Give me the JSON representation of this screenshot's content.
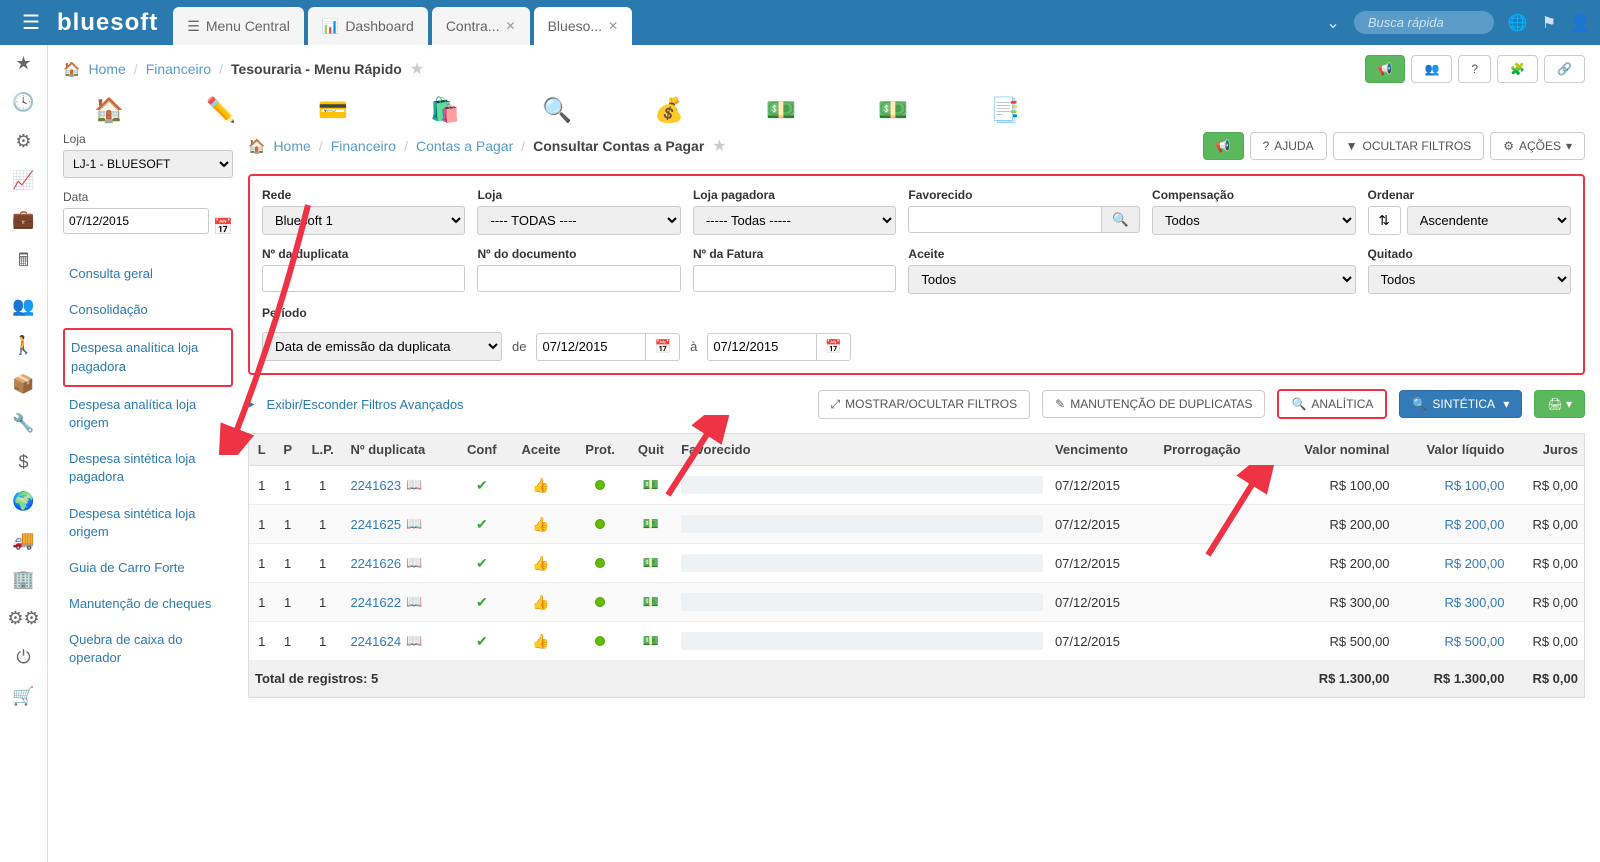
{
  "topbar": {
    "logo": "bluesoft",
    "tabs": [
      {
        "label": "Menu Central",
        "icon": "list"
      },
      {
        "label": "Dashboard",
        "icon": "chart"
      },
      {
        "label": "Contra...",
        "icon": "",
        "closable": true
      },
      {
        "label": "Blueso...",
        "icon": "",
        "closable": true,
        "active": true
      }
    ],
    "search_placeholder": "Busca rápida"
  },
  "breadcrumb1": {
    "home": "Home",
    "p1": "Financeiro",
    "current": "Tesouraria - Menu Rápido"
  },
  "sidebar": {
    "loja_label": "Loja",
    "loja_value": "LJ-1 - BLUESOFT",
    "data_label": "Data",
    "data_value": "07/12/2015",
    "links": [
      "Consulta geral",
      "Consolidação",
      "Despesa analítica loja pagadora",
      "Despesa analítica loja origem",
      "Despesa sintética loja pagadora",
      "Despesa sintética loja origem",
      "Guia de Carro Forte",
      "Manutenção de cheques",
      "Quebra de caixa do operador"
    ],
    "highlighted_index": 2
  },
  "breadcrumb2": {
    "home": "Home",
    "p1": "Financeiro",
    "p2": "Contas a Pagar",
    "current": "Consultar Contas a Pagar",
    "ajuda": "AJUDA",
    "ocultar": "OCULTAR FILTROS",
    "acoes": "AÇÕES"
  },
  "filters": {
    "rede_label": "Rede",
    "rede_value": "Bluesoft 1",
    "loja_label": "Loja",
    "loja_value": "---- TODAS ----",
    "lojapag_label": "Loja pagadora",
    "lojapag_value": "----- Todas -----",
    "fav_label": "Favorecido",
    "comp_label": "Compensação",
    "comp_value": "Todos",
    "ord_label": "Ordenar",
    "ord_value": "Ascendente",
    "ndup_label": "Nº da duplicata",
    "ndoc_label": "Nº do documento",
    "nfat_label": "Nº da Fatura",
    "aceite_label": "Aceite",
    "aceite_value": "Todos",
    "quit_label": "Quitado",
    "quit_value": "Todos",
    "periodo_label": "Período",
    "periodo_value": "Data de emissão da duplicata",
    "de": "de",
    "a": "à",
    "d1": "07/12/2015",
    "d2": "07/12/2015"
  },
  "advanced": {
    "link": "Exibir/Esconder Filtros Avançados",
    "mostrar": "MOSTRAR/OCULTAR FILTROS",
    "manut": "MANUTENÇÃO DE DUPLICATAS",
    "analitica": "ANALÍTICA",
    "sintetica": "SINTÉTICA"
  },
  "table": {
    "headers": {
      "l": "L",
      "p": "P",
      "lp": "L.P.",
      "ndup": "Nº duplicata",
      "conf": "Conf",
      "aceite": "Aceite",
      "prot": "Prot.",
      "quit": "Quit",
      "fav": "Favorecido",
      "venc": "Vencimento",
      "pror": "Prorrogação",
      "vnom": "Valor nominal",
      "vliq": "Valor líquido",
      "juros": "Juros"
    },
    "rows": [
      {
        "l": "1",
        "p": "1",
        "lp": "1",
        "ndup": "2241623",
        "venc": "07/12/2015",
        "vnom": "R$ 100,00",
        "vliq": "R$ 100,00",
        "juros": "R$ 0,00"
      },
      {
        "l": "1",
        "p": "1",
        "lp": "1",
        "ndup": "2241625",
        "venc": "07/12/2015",
        "vnom": "R$ 200,00",
        "vliq": "R$ 200,00",
        "juros": "R$ 0,00"
      },
      {
        "l": "1",
        "p": "1",
        "lp": "1",
        "ndup": "2241626",
        "venc": "07/12/2015",
        "vnom": "R$ 200,00",
        "vliq": "R$ 200,00",
        "juros": "R$ 0,00"
      },
      {
        "l": "1",
        "p": "1",
        "lp": "1",
        "ndup": "2241622",
        "venc": "07/12/2015",
        "vnom": "R$ 300,00",
        "vliq": "R$ 300,00",
        "juros": "R$ 0,00"
      },
      {
        "l": "1",
        "p": "1",
        "lp": "1",
        "ndup": "2241624",
        "venc": "07/12/2015",
        "vnom": "R$ 500,00",
        "vliq": "R$ 500,00",
        "juros": "R$ 0,00"
      }
    ],
    "footer": {
      "label": "Total de registros: 5",
      "vnom": "R$ 1.300,00",
      "vliq": "R$ 1.300,00",
      "juros": "R$ 0,00"
    }
  }
}
